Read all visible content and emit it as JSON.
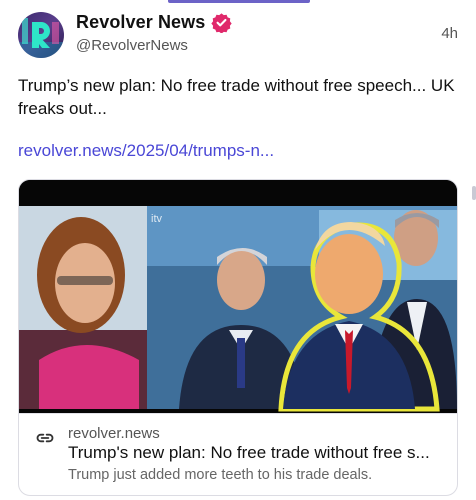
{
  "post": {
    "author": {
      "display_name": "Revolver News",
      "handle": "@RevolverNews",
      "verified": true,
      "avatar_icon": "revolver-r-logo-icon"
    },
    "timestamp": "4h",
    "text": "Trump’s new plan: No free trade without free speech... UK freaks out...",
    "link_text": "revolver.news/2025/04/trumps-n..."
  },
  "card": {
    "media_watermark": "itv",
    "domain": "revolver.news",
    "title": "Trump's new plan: No free trade without free s...",
    "description": "Trump just added more teeth to his trade deals.",
    "icon": "link-chain-icon"
  },
  "colors": {
    "link": "#4a47d6",
    "verified_badge": "#e0296b",
    "tab_indicator": "#6c63c7"
  }
}
